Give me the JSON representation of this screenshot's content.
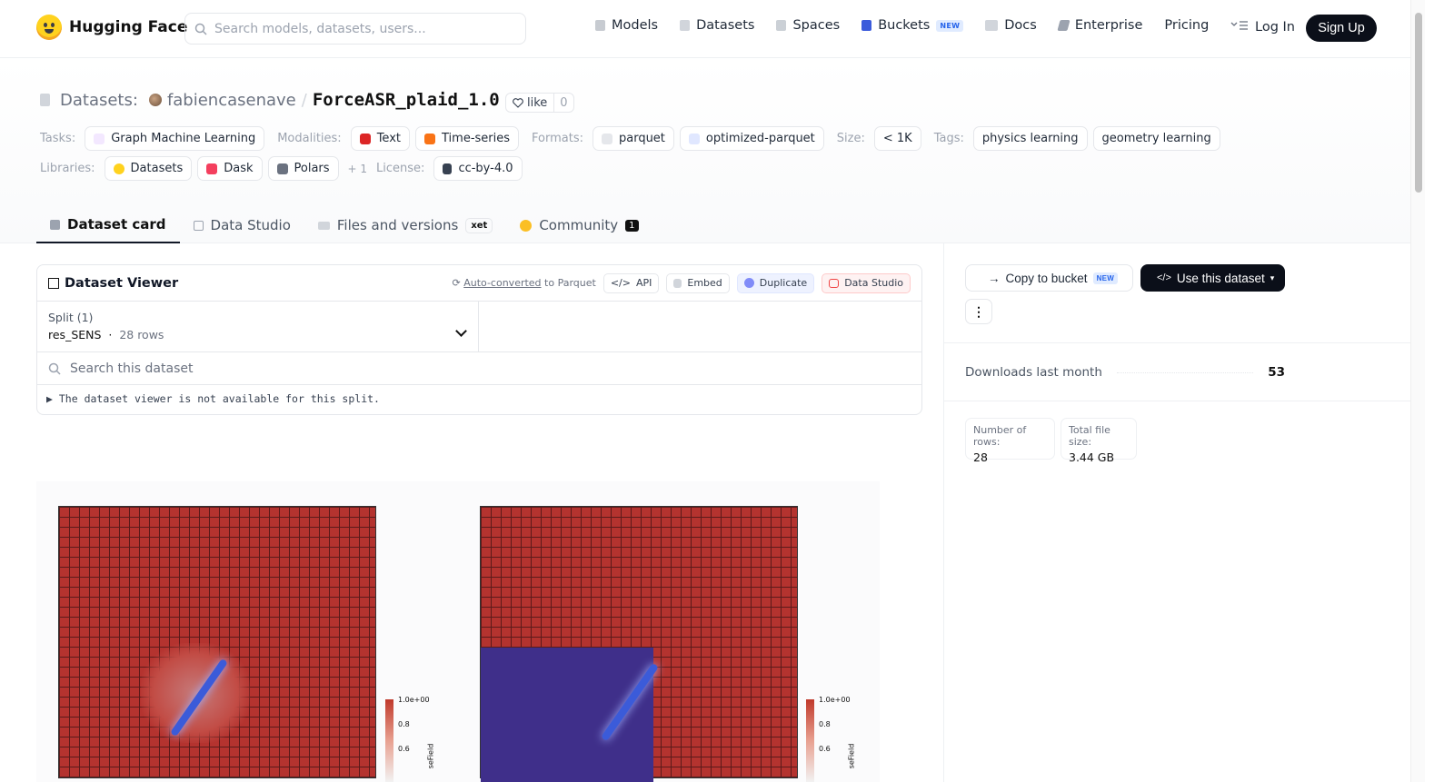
{
  "header": {
    "brand": "Hugging Face",
    "search_placeholder": "Search models, datasets, users...",
    "nav": [
      {
        "label": "Models",
        "icon": "cube-icon",
        "color": "#9ca3af"
      },
      {
        "label": "Datasets",
        "icon": "database-icon",
        "color": "#9ca3af"
      },
      {
        "label": "Spaces",
        "icon": "grid-icon",
        "color": "#9ca3af"
      },
      {
        "label": "Buckets",
        "icon": "bucket-icon",
        "color": "#3b5bdb",
        "badge": "NEW"
      },
      {
        "label": "Docs",
        "icon": "book-icon",
        "color": "#9ca3af"
      },
      {
        "label": "Enterprise",
        "icon": "enterprise-icon",
        "color": "#9ca3af"
      },
      {
        "label": "Pricing"
      }
    ],
    "login": "Log In",
    "signup": "Sign Up"
  },
  "repo": {
    "section": "Datasets:",
    "owner": "fabiencasenave",
    "separator": "/",
    "name": "ForceASR_plaid_1.0",
    "like_label": "like",
    "like_count": "0"
  },
  "tags": {
    "tasks_label": "Tasks:",
    "tasks": [
      "Graph Machine Learning"
    ],
    "modalities_label": "Modalities:",
    "modalities": [
      "Text",
      "Time-series"
    ],
    "formats_label": "Formats:",
    "formats": [
      "parquet",
      "optimized-parquet"
    ],
    "size_label": "Size:",
    "size": "< 1K",
    "tags_label": "Tags:",
    "tags": [
      "physics learning",
      "geometry learning"
    ],
    "libraries_label": "Libraries:",
    "libraries": [
      "Datasets",
      "Dask",
      "Polars"
    ],
    "libraries_more": "+ 1",
    "license_label": "License:",
    "license": "cc-by-4.0"
  },
  "tabs": [
    {
      "label": "Dataset card",
      "active": true
    },
    {
      "label": "Data Studio"
    },
    {
      "label": "Files and versions",
      "badge": "xet"
    },
    {
      "label": "Community",
      "count": "1"
    }
  ],
  "viewer": {
    "title": "Dataset Viewer",
    "auto_converted": "Auto-converted",
    "to_parquet": "to Parquet",
    "api": "API",
    "embed": "Embed",
    "duplicate": "Duplicate",
    "data_studio": "Data Studio",
    "split_label": "Split (1)",
    "split_name": "res_SENS",
    "split_rows": "28 rows",
    "search_placeholder": "Search this dataset",
    "not_available": "The dataset viewer is not available for this split."
  },
  "figure": {
    "colorbar_ticks": [
      "1.0e+00",
      "0.8",
      "0.6"
    ],
    "colorbar_name": "seField"
  },
  "sidebar": {
    "copy_bucket": "Copy to bucket",
    "copy_bucket_badge": "NEW",
    "use_dataset": "Use this dataset",
    "downloads_label": "Downloads last month",
    "downloads": "53",
    "rows_label": "Number of rows:",
    "rows": "28",
    "size_label": "Total file size:",
    "size": "3.44 GB"
  }
}
